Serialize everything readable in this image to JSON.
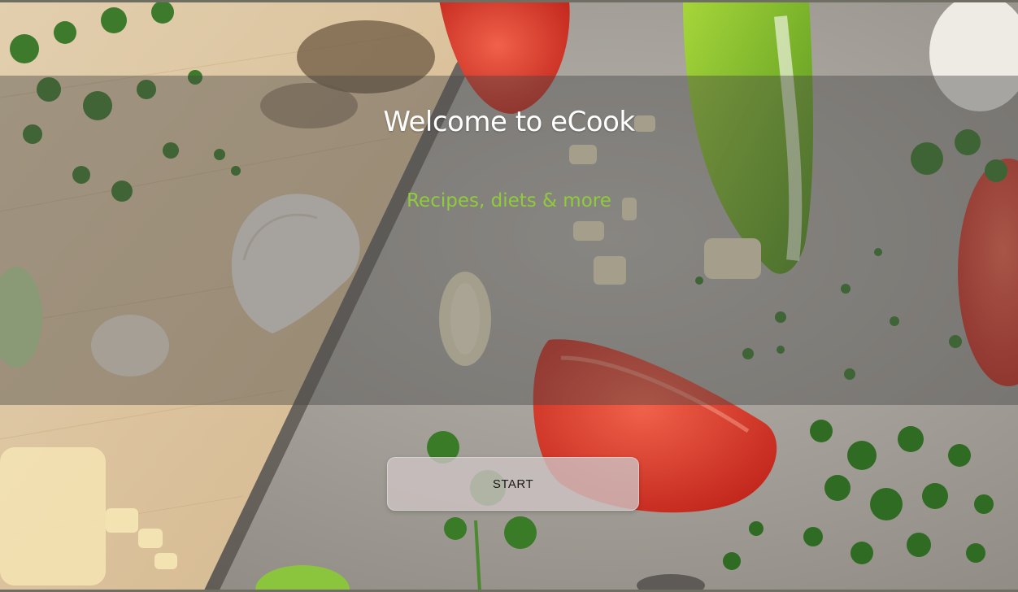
{
  "hero": {
    "title": "Welcome to eCook",
    "subtitle": "Recipes, diets & more",
    "start_label": "START"
  },
  "colors": {
    "title": "#ffffff",
    "subtitle_accent": "#8fcc3a",
    "overlay": "#464646",
    "button_bg": "#cdc3c3"
  },
  "background": {
    "image": "cutting-board-with-vegetables-photo"
  }
}
